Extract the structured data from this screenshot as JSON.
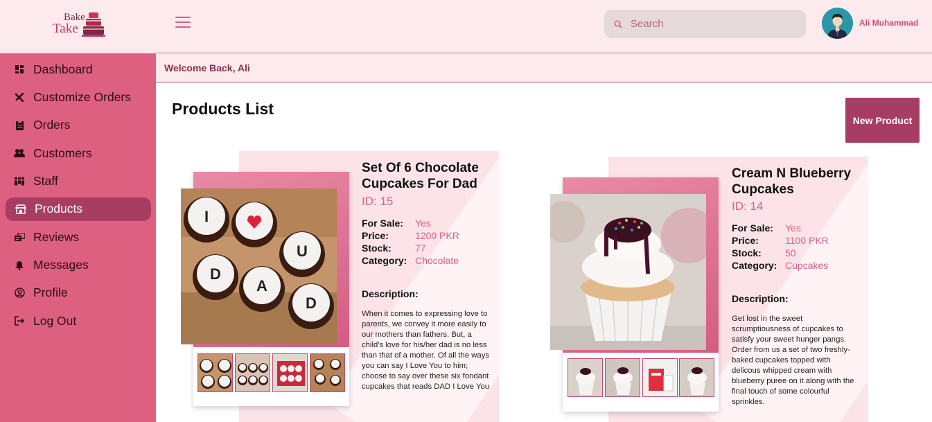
{
  "brand": {
    "line1": "Bake",
    "line2": "Take"
  },
  "nav": [
    {
      "label": "Dashboard",
      "icon": "grid-icon"
    },
    {
      "label": "Customize Orders",
      "icon": "tools-icon"
    },
    {
      "label": "Orders",
      "icon": "clipboard-icon"
    },
    {
      "label": "Customers",
      "icon": "users-icon"
    },
    {
      "label": "Staff",
      "icon": "staff-icon"
    },
    {
      "label": "Products",
      "icon": "store-icon",
      "active": true
    },
    {
      "label": "Reviews",
      "icon": "reviews-icon"
    },
    {
      "label": "Messages",
      "icon": "bell-icon"
    },
    {
      "label": "Profile",
      "icon": "user-circle-icon"
    },
    {
      "label": "Log Out",
      "icon": "logout-icon"
    }
  ],
  "header": {
    "search_placeholder": "Search",
    "user_name": "Ali Muhammad"
  },
  "welcome": "Welcome Back, Ali",
  "page_title": "Products List",
  "new_product_label": "New Product",
  "products": [
    {
      "title": "Set Of 6 Chocolate Cupcakes For Dad",
      "id": "ID: 15",
      "for_sale_label": "For Sale:",
      "for_sale": "Yes",
      "price_label": "Price:",
      "price": "1200 PKR",
      "stock_label": "Stock:",
      "stock": "77",
      "category_label": "Category:",
      "category": "Chocolate",
      "description_label": "Description:",
      "description": "When it comes to expressing love to parents, we convey it more easily to our mothers than fathers. But, a child's love for his/her dad is no less than that of a mother. Of all the ways you can say I Love You to him; choose to say over these six fondant cupcakes that reads DAD I Love You"
    },
    {
      "title": "Cream N Blueberry Cupcakes",
      "id": "ID: 14",
      "for_sale_label": "For Sale:",
      "for_sale": "Yes",
      "price_label": "Price:",
      "price": "1100 PKR",
      "stock_label": "Stock:",
      "stock": "50",
      "category_label": "Category:",
      "category": "Cupcakes",
      "description_label": "Description:",
      "description": "Get lost in the sweet scrumptiousness of cupcakes to satisfy your sweet hunger pangs. Order from us a set of two freshly-baked cupcakes topped with delicous whipped cream with blueberry puree on it along with the final touch of some colourful sprinkles."
    }
  ],
  "colors": {
    "sidebar": "#de6081",
    "active": "#a83d63",
    "accent": "#d8608a",
    "header_bg": "#fdeaec"
  }
}
